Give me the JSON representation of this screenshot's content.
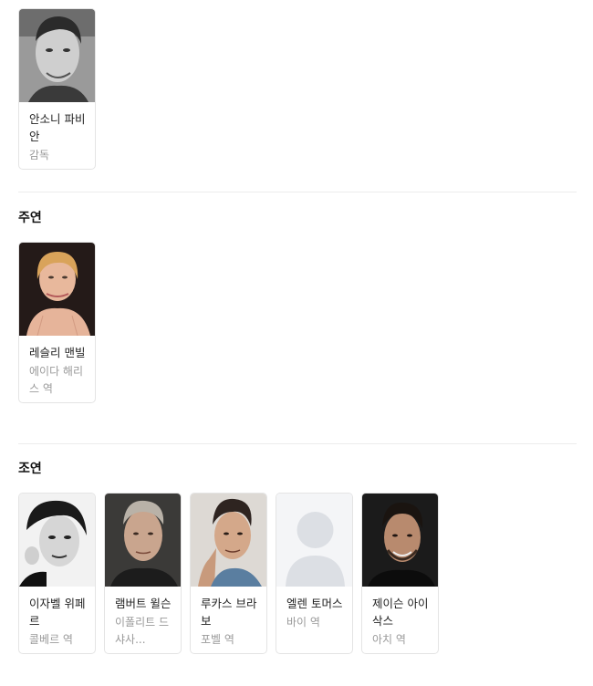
{
  "director": {
    "people": [
      {
        "name": "안소니 파비안",
        "role": "감독"
      }
    ]
  },
  "lead": {
    "title": "주연",
    "people": [
      {
        "name": "레슬리 맨빌",
        "role": "에이다 해리스 역"
      }
    ]
  },
  "supporting": {
    "title": "조연",
    "people": [
      {
        "name": "이자벨 위페르",
        "role": "콜베르 역"
      },
      {
        "name": "램버트 윌슨",
        "role": "이폴리트 드 샤사..."
      },
      {
        "name": "루카스 브라보",
        "role": "포벨 역"
      },
      {
        "name": "엘렌 토머스",
        "role": "바이 역"
      },
      {
        "name": "제이슨 아이삭스",
        "role": "아치 역"
      }
    ]
  }
}
